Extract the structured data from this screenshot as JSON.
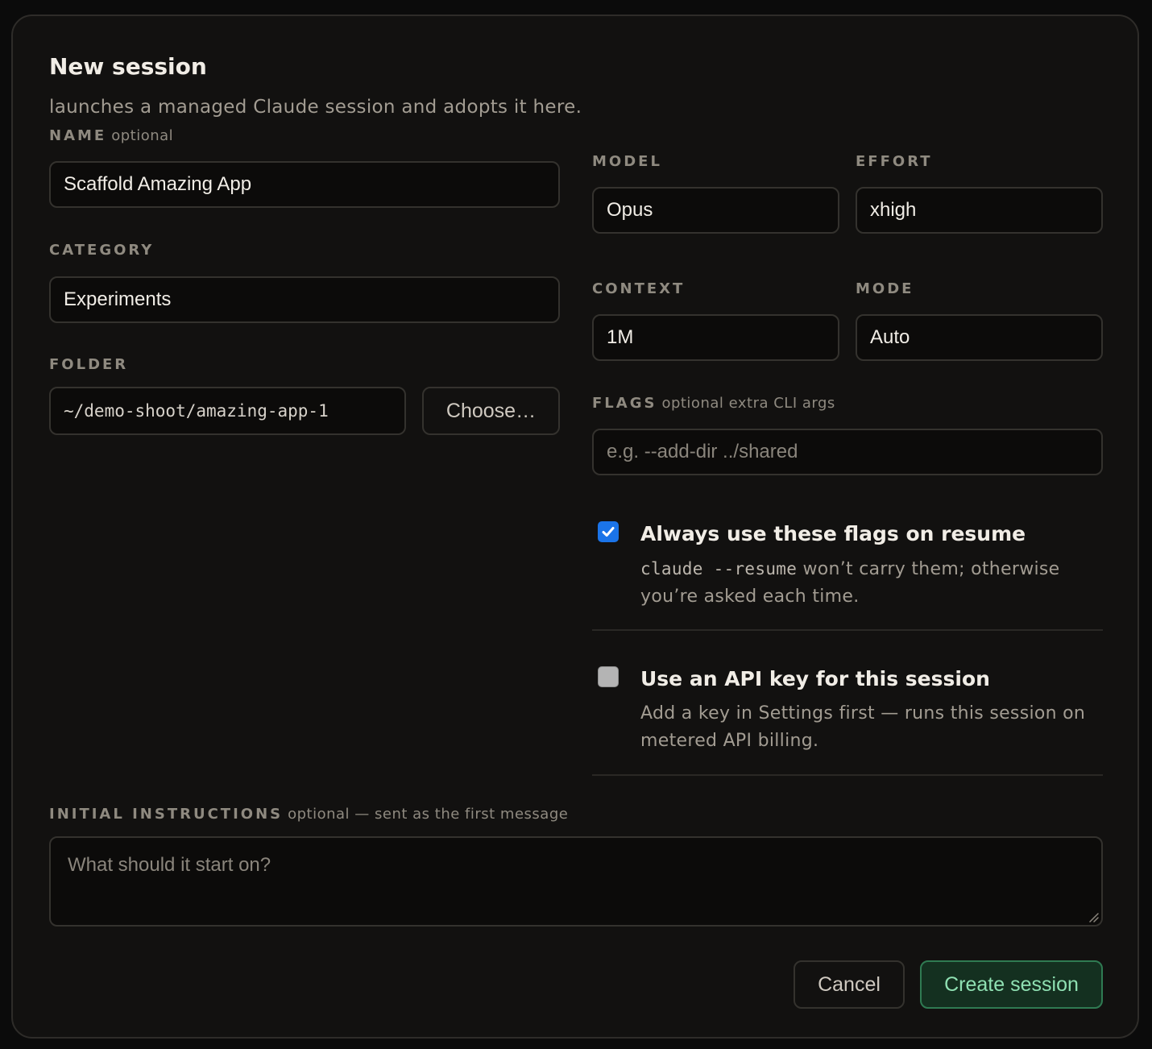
{
  "dialog": {
    "title": "New session",
    "subtitle": "launches a managed Claude session and adopts it here."
  },
  "name": {
    "label": "NAME",
    "hint": "optional",
    "value": "Scaffold Amazing App"
  },
  "category": {
    "label": "CATEGORY",
    "value": "Experiments"
  },
  "folder": {
    "label": "FOLDER",
    "value": "~/demo-shoot/amazing-app-1",
    "choose_label": "Choose…"
  },
  "model": {
    "label": "MODEL",
    "value": "Opus"
  },
  "effort": {
    "label": "EFFORT",
    "value": "xhigh"
  },
  "context": {
    "label": "CONTEXT",
    "value": "1M"
  },
  "mode": {
    "label": "MODE",
    "value": "Auto"
  },
  "flags": {
    "label": "FLAGS",
    "hint": "optional extra CLI args",
    "placeholder": "e.g. --add-dir ../shared",
    "value": ""
  },
  "options": {
    "always_flags": {
      "checked": true,
      "title": "Always use these flags on resume",
      "desc_code": "claude --resume",
      "desc_rest": " won’t carry them; otherwise you’re asked each time."
    },
    "api_key": {
      "checked": false,
      "title": "Use an API key for this session",
      "desc": "Add a key in Settings first — runs this session on metered API billing."
    }
  },
  "instructions": {
    "label": "INITIAL INSTRUCTIONS",
    "hint": "optional — sent as the first message",
    "placeholder": "What should it start on?"
  },
  "footer": {
    "cancel_label": "Cancel",
    "create_label": "Create session"
  },
  "colors": {
    "background": "#121110",
    "field_bg": "#0c0b0a",
    "border": "#34322e",
    "accent_green": "#8fe0b2",
    "checkbox_blue": "#1b74e8"
  }
}
